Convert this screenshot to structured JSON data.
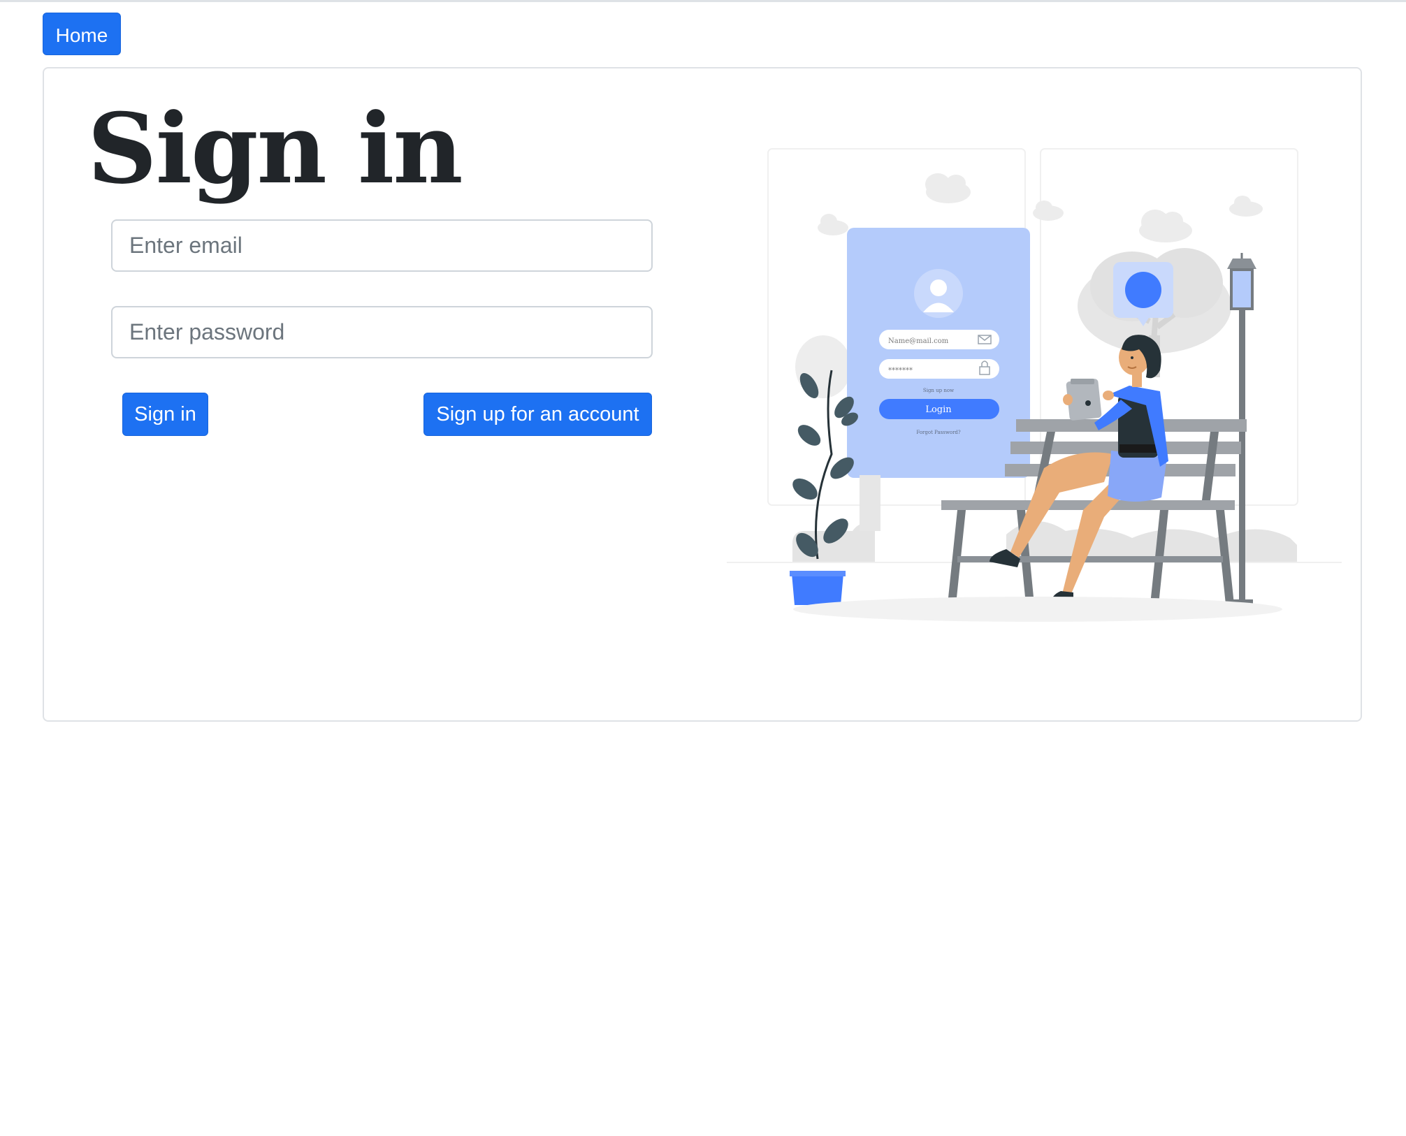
{
  "nav": {
    "home_label": "Home"
  },
  "form": {
    "title": "Sign in",
    "email_placeholder": "Enter email",
    "password_placeholder": "Enter password",
    "signin_label": "Sign in",
    "signup_label": "Sign up for an account"
  },
  "illustration": {
    "email_field_text": "Name@mail.com",
    "password_field_text": "*******",
    "signup_link_text": "Sign up now",
    "login_button_text": "Login",
    "forgot_text": "Forgot Password?"
  },
  "colors": {
    "primary": "#1d71f2",
    "panel": "#b4cbfb",
    "accent": "#407bff",
    "skin": "#e9ad79",
    "gray": "#757b80"
  }
}
